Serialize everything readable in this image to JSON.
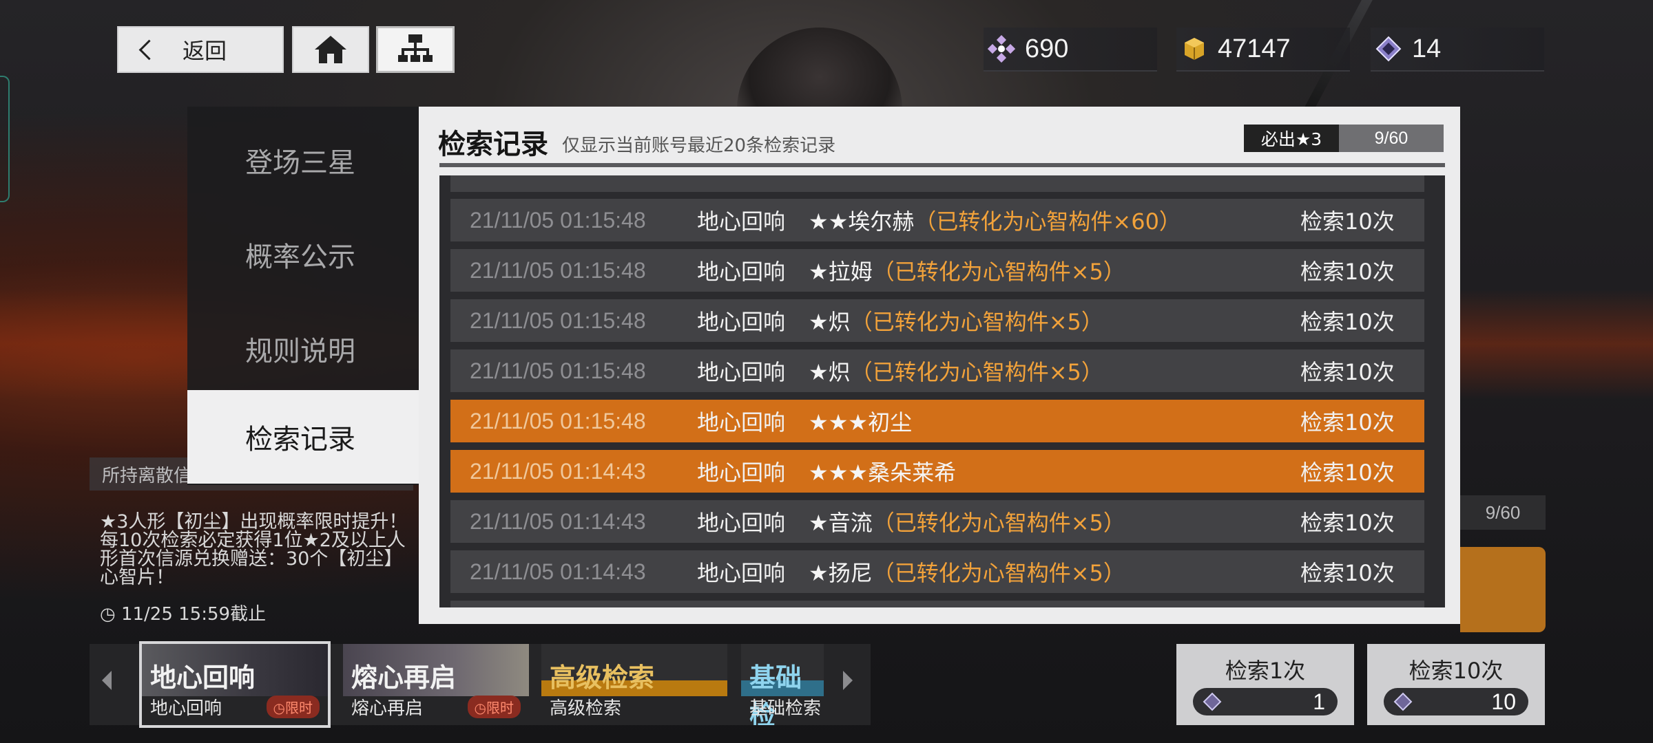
{
  "topbar": {
    "back_label": "返回",
    "currencies": [
      {
        "icon": "crystal-icon",
        "value": "690"
      },
      {
        "icon": "gold-cube-icon",
        "value": "47147"
      },
      {
        "icon": "diamond-ticket-icon",
        "value": "14"
      }
    ]
  },
  "menu": {
    "items": [
      {
        "label": "登场三星",
        "active": false
      },
      {
        "label": "概率公示",
        "active": false
      },
      {
        "label": "规则说明",
        "active": false
      },
      {
        "label": "检索记录",
        "active": true
      }
    ]
  },
  "panel": {
    "title": "检索记录",
    "subtitle": "仅显示当前账号最近20条检索记录",
    "guarantee_label": "必出★3",
    "guarantee_count": "9/60",
    "records": [
      {
        "time": "21/11/05 01:15:48",
        "pool": "地心回响",
        "name": "★★埃尔赫",
        "conversion": "（已转化为心智构件×60）",
        "count": "检索10次",
        "highlight": false
      },
      {
        "time": "21/11/05 01:15:48",
        "pool": "地心回响",
        "name": "★拉姆",
        "conversion": "（已转化为心智构件×5）",
        "count": "检索10次",
        "highlight": false
      },
      {
        "time": "21/11/05 01:15:48",
        "pool": "地心回响",
        "name": "★炽",
        "conversion": "（已转化为心智构件×5）",
        "count": "检索10次",
        "highlight": false
      },
      {
        "time": "21/11/05 01:15:48",
        "pool": "地心回响",
        "name": "★炽",
        "conversion": "（已转化为心智构件×5）",
        "count": "检索10次",
        "highlight": false
      },
      {
        "time": "21/11/05 01:15:48",
        "pool": "地心回响",
        "name": "★★★初尘",
        "conversion": "",
        "count": "检索10次",
        "highlight": true
      },
      {
        "time": "21/11/05 01:14:43",
        "pool": "地心回响",
        "name": "★★★桑朵莱希",
        "conversion": "",
        "count": "检索10次",
        "highlight": true
      },
      {
        "time": "21/11/05 01:14:43",
        "pool": "地心回响",
        "name": "★音流",
        "conversion": "（已转化为心智构件×5）",
        "count": "检索10次",
        "highlight": false
      },
      {
        "time": "21/11/05 01:14:43",
        "pool": "地心回响",
        "name": "★扬尼",
        "conversion": "（已转化为心智构件×5）",
        "count": "检索10次",
        "highlight": false
      }
    ]
  },
  "behind": {
    "label": "所持离散信",
    "desc": "★3人形【初尘】出现概率限时提升！每10次检索必定获得1位★2及以上人形首次信源兑换赠送：30个【初尘】心智片！",
    "time": "◷ 11/25 15:59截止",
    "right_badge": "9/60"
  },
  "banners": [
    {
      "title": "地心回响",
      "label": "地心回响",
      "tag": "◷限时",
      "selected": true
    },
    {
      "title": "熔心再启",
      "label": "熔心再启",
      "tag": "◷限时",
      "selected": false
    },
    {
      "title": "高级检索",
      "label": "高级检索",
      "tag": "",
      "selected": false
    },
    {
      "title": "基础检",
      "label": "基础检索",
      "tag": "",
      "selected": false
    }
  ],
  "actions": [
    {
      "label": "检索1次",
      "cost": "1"
    },
    {
      "label": "检索10次",
      "cost": "10"
    }
  ],
  "colors": {
    "highlight_row": "#d26f18",
    "conversion_text": "#f2a23a",
    "panel_bg": "#ececed"
  }
}
